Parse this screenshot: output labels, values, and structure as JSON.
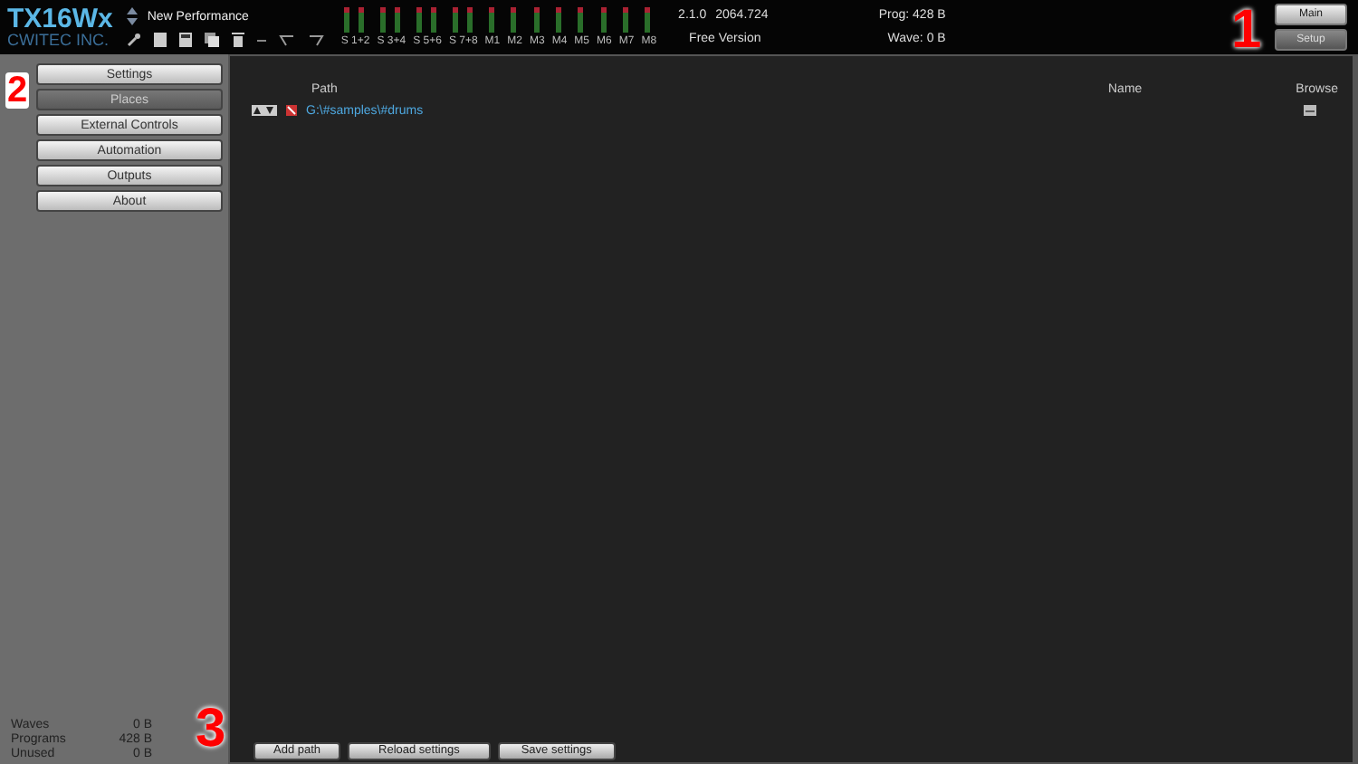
{
  "header": {
    "logo": "TX16Wx",
    "company": "CWITEC INC.",
    "performance": "New Performance",
    "channels": [
      "S 1+2",
      "S 3+4",
      "S 5+6",
      "S 7+8",
      "M1",
      "M2",
      "M3",
      "M4",
      "M5",
      "M6",
      "M7",
      "M8"
    ],
    "version": "2.1.0",
    "build": "2064.724",
    "edition": "Free Version",
    "prog": "Prog: 428 B",
    "wave": "Wave: 0 B"
  },
  "mode_buttons": [
    {
      "label": "Main",
      "selected": false
    },
    {
      "label": "Setup",
      "selected": true
    }
  ],
  "sidebar": {
    "items": [
      {
        "label": "Settings",
        "selected": false
      },
      {
        "label": "Places",
        "selected": true
      },
      {
        "label": "External Controls",
        "selected": false
      },
      {
        "label": "Automation",
        "selected": false
      },
      {
        "label": "Outputs",
        "selected": false
      },
      {
        "label": "About",
        "selected": false
      }
    ],
    "stats": [
      {
        "label": "Waves",
        "value": "0 B"
      },
      {
        "label": "Programs",
        "value": "428 B"
      },
      {
        "label": "Unused",
        "value": "0 B"
      }
    ]
  },
  "table": {
    "columns": [
      "Path",
      "Name",
      "Browse"
    ],
    "rows": [
      {
        "path": "G:\\#samples\\#drums",
        "name": ""
      }
    ]
  },
  "actions": [
    "Add path",
    "Reload settings",
    "Save settings"
  ],
  "callouts": [
    "1",
    "2",
    "3"
  ]
}
